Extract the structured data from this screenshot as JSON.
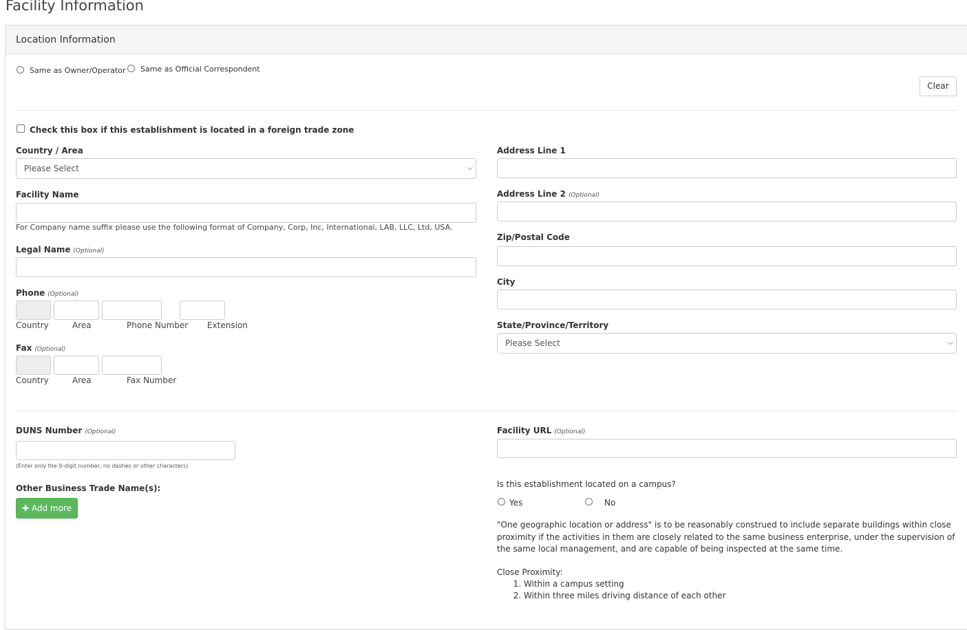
{
  "page": {
    "title": "Facility Information"
  },
  "panel": {
    "heading": "Location Information"
  },
  "same_as": {
    "owner_operator": "Same as Owner/Operator",
    "official_correspondent": "Same as Official Correspondent"
  },
  "buttons": {
    "clear": "Clear",
    "add_more": "Add more"
  },
  "foreign_trade_zone": {
    "label": "Check this box if this establishment is located in a foreign trade zone"
  },
  "country_area": {
    "label": "Country / Area",
    "value": "Please Select"
  },
  "facility_name": {
    "label": "Facility Name",
    "help": "For Company name suffix please use the following format of Company, Corp, Inc, International, LAB, LLC, Ltd, USA."
  },
  "legal_name": {
    "label": "Legal Name",
    "optional": "(Optional)"
  },
  "phone": {
    "label": "Phone",
    "optional": "(Optional)",
    "sublabels": {
      "country": "Country",
      "area": "Area",
      "number": "Phone Number",
      "extension": "Extension"
    }
  },
  "fax": {
    "label": "Fax",
    "optional": "(Optional)",
    "sublabels": {
      "country": "Country",
      "area": "Area",
      "number": "Fax Number"
    }
  },
  "address1": {
    "label": "Address Line 1"
  },
  "address2": {
    "label": "Address Line 2",
    "optional": "(Optional)"
  },
  "zip": {
    "label": "Zip/Postal Code"
  },
  "city": {
    "label": "City"
  },
  "state": {
    "label": "State/Province/Territory",
    "value": "Please Select"
  },
  "duns": {
    "label": "DUNS Number",
    "optional": "(Optional)",
    "help": "(Enter only the 9-digit number, no dashes or other characters)"
  },
  "trade_names": {
    "label": "Other Business Trade Name(s):"
  },
  "facility_url": {
    "label": "Facility URL",
    "optional": "(Optional)"
  },
  "campus": {
    "question": "Is this establishment located on a campus?",
    "yes": "Yes",
    "no": "No",
    "paragraph": "\"One geographic location or address\" is to be reasonably construed to include separate buildings within close proximity if the activities in them are closely related to the same business enterprise, under the supervision of the same local management, and are capable of being inspected at the same time.",
    "proximity_title": "Close Proximity:",
    "proximity_items": [
      "Within a campus setting",
      "Within three miles driving distance of each other"
    ]
  },
  "icons": {
    "plus": "plus-icon",
    "chevron": "chevron-down-icon"
  },
  "colors": {
    "success": "#5cb85c",
    "panel_header": "#f5f5f5",
    "border": "#cccccc"
  }
}
